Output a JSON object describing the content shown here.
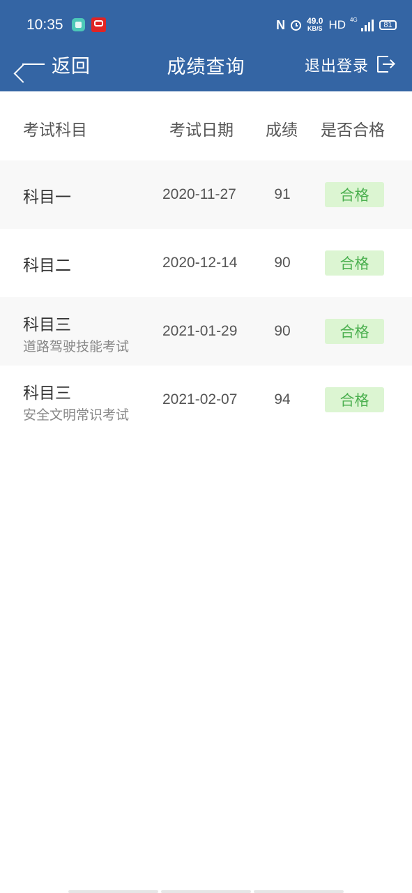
{
  "status_bar": {
    "time": "10:35",
    "nfc": "N",
    "speed_value": "49.0",
    "speed_unit": "KB/S",
    "hd": "HD",
    "network": "4G",
    "battery": "81"
  },
  "nav": {
    "back_label": "返回",
    "title": "成绩查询",
    "logout_label": "退出登录"
  },
  "table": {
    "headers": {
      "subject": "考试科目",
      "date": "考试日期",
      "score": "成绩",
      "pass": "是否合格"
    },
    "rows": [
      {
        "subject": "科目一",
        "sub": "",
        "date": "2020-11-27",
        "score": "91",
        "status": "合格"
      },
      {
        "subject": "科目二",
        "sub": "",
        "date": "2020-12-14",
        "score": "90",
        "status": "合格"
      },
      {
        "subject": "科目三",
        "sub": "道路驾驶技能考试",
        "date": "2021-01-29",
        "score": "90",
        "status": "合格"
      },
      {
        "subject": "科目三",
        "sub": "安全文明常识考试",
        "date": "2021-02-07",
        "score": "94",
        "status": "合格"
      }
    ]
  },
  "colors": {
    "header_bg": "#3465a4",
    "pass_bg": "#dcf5d2",
    "pass_text": "#4cb050"
  },
  "icons": [
    "back-arrow-icon",
    "logout-icon",
    "alarm-icon",
    "signal-icon",
    "battery-icon"
  ]
}
